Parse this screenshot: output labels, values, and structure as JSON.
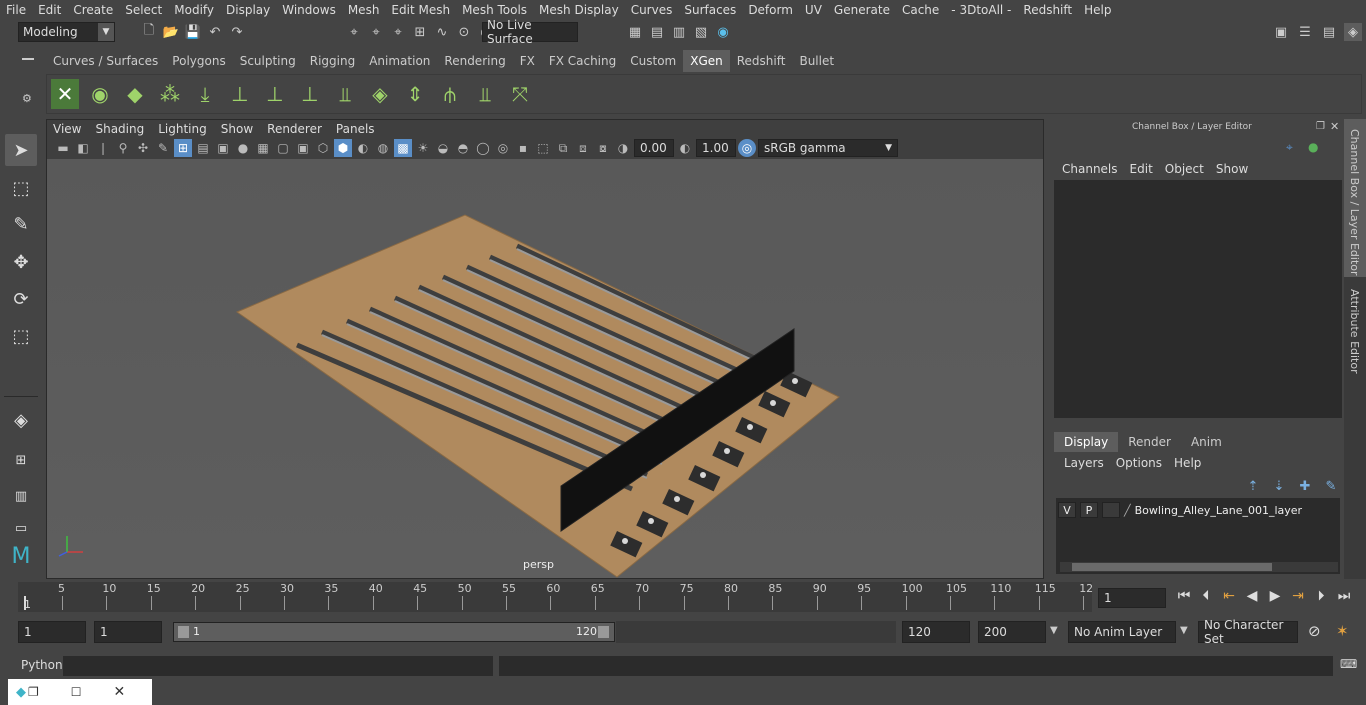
{
  "menubar": [
    "File",
    "Edit",
    "Create",
    "Select",
    "Modify",
    "Display",
    "Windows",
    "Mesh",
    "Edit Mesh",
    "Mesh Tools",
    "Mesh Display",
    "Curves",
    "Surfaces",
    "Deform",
    "UV",
    "Generate",
    "Cache",
    "- 3DtoAll -",
    "Redshift",
    "Help"
  ],
  "mode_menu": {
    "value": "Modeling"
  },
  "live_surface": "No Live Surface",
  "shelf_tabs": [
    "Curves / Surfaces",
    "Polygons",
    "Sculpting",
    "Rigging",
    "Animation",
    "Rendering",
    "FX",
    "FX Caching",
    "Custom",
    "XGen",
    "Redshift",
    "Bullet"
  ],
  "active_shelf_tab": "XGen",
  "viewport": {
    "menu": [
      "View",
      "Shading",
      "Lighting",
      "Show",
      "Renderer",
      "Panels"
    ],
    "near_value": "0.00",
    "far_value": "1.00",
    "color_space": "sRGB gamma",
    "camera": "persp"
  },
  "right_panel": {
    "title": "Channel Box / Layer Editor",
    "menu": [
      "Channels",
      "Edit",
      "Object",
      "Show"
    ],
    "tabs": [
      "Display",
      "Render",
      "Anim"
    ],
    "active_tab": "Display",
    "layer_menu": [
      "Layers",
      "Options",
      "Help"
    ],
    "layers": [
      {
        "v": "V",
        "p": "P",
        "name": "Bowling_Alley_Lane_001_layer"
      }
    ],
    "side_tabs": [
      "Channel Box / Layer Editor",
      "Attribute Editor"
    ]
  },
  "timeline": {
    "ticks": [
      "5",
      "10",
      "15",
      "20",
      "25",
      "30",
      "35",
      "40",
      "45",
      "50",
      "55",
      "60",
      "65",
      "70",
      "75",
      "80",
      "85",
      "90",
      "95",
      "100",
      "105",
      "110",
      "115",
      "12"
    ],
    "start_marker": "1",
    "current_frame": "1"
  },
  "range": {
    "start": "1",
    "start2": "1",
    "slider_start": "1",
    "slider_end": "120",
    "end": "120",
    "anim_end": "200",
    "anim_layer": "No Anim Layer",
    "character_set": "No Character Set"
  },
  "command": {
    "label": "Python"
  }
}
